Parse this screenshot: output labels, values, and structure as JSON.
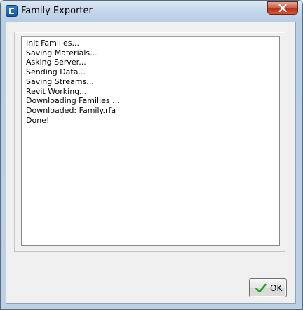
{
  "window": {
    "title": "Family Exporter",
    "icon": "revit-app-icon",
    "close_icon": "close-icon"
  },
  "log": {
    "lines": [
      "Init Families...",
      "Saving Materials...",
      "Asking Server...",
      "Sending Data...",
      "Saving Streams...",
      "Revit Working...",
      "Downloading Families ...",
      "Downloaded: Family.rfa",
      "Done!"
    ]
  },
  "ok_button": {
    "label": "OK",
    "icon": "checkmark-icon",
    "icon_color": "#2e9e2e"
  },
  "colors": {
    "close_button": "#c8462f",
    "title_bar": "#c4d6ea"
  }
}
